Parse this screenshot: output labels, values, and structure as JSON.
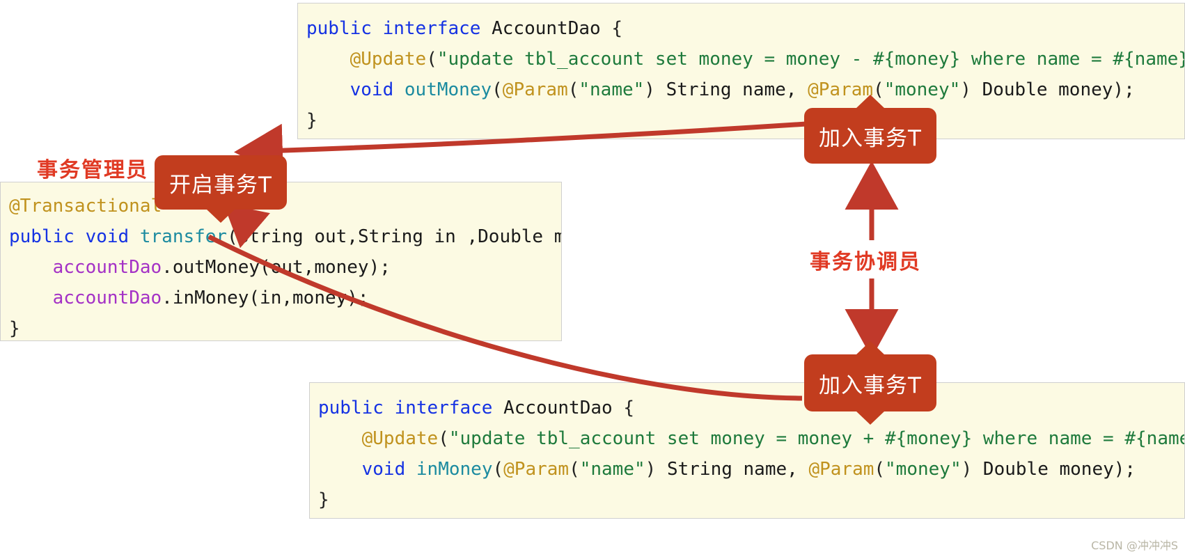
{
  "theme": {
    "code_bg": "#FCFAE3",
    "code_border": "#cfcfcf",
    "badge_bg": "#C23D1E",
    "label_red": "#E03A24",
    "arrow_red": "#C0392B",
    "keyword_blue": "#1532E3",
    "annotation_gold": "#C0921E",
    "string_green": "#1E7A3C",
    "method_teal": "#1C8BA0",
    "field_purple": "#A431C6",
    "page_bg": "#ffffff"
  },
  "labels": {
    "transaction_manager": "事务管理员",
    "transaction_coordinator": "事务协调员"
  },
  "badges": {
    "start_transaction": "开启事务T",
    "join_transaction_top": "加入事务T",
    "join_transaction_bottom": "加入事务T"
  },
  "code_panels": {
    "out_money": {
      "lines": [
        [
          {
            "t": "public",
            "c": "kw"
          },
          {
            "t": " ",
            "c": "plain"
          },
          {
            "t": "interface",
            "c": "kw"
          },
          {
            "t": " ",
            "c": "plain"
          },
          {
            "t": "AccountDao",
            "c": "type"
          },
          {
            "t": " {",
            "c": "punc"
          }
        ],
        [
          {
            "t": "    ",
            "c": "plain"
          },
          {
            "t": "@Update",
            "c": "ann"
          },
          {
            "t": "(",
            "c": "punc"
          },
          {
            "t": "\"update tbl_account set money = money - #{money} where name = #{name}\"",
            "c": "str"
          },
          {
            "t": ")",
            "c": "punc"
          }
        ],
        [
          {
            "t": "    ",
            "c": "plain"
          },
          {
            "t": "void",
            "c": "kw"
          },
          {
            "t": " ",
            "c": "plain"
          },
          {
            "t": "outMoney",
            "c": "mth"
          },
          {
            "t": "(",
            "c": "punc"
          },
          {
            "t": "@Param",
            "c": "ann"
          },
          {
            "t": "(",
            "c": "punc"
          },
          {
            "t": "\"name\"",
            "c": "str"
          },
          {
            "t": ") ",
            "c": "punc"
          },
          {
            "t": "String",
            "c": "type"
          },
          {
            "t": " name, ",
            "c": "plain"
          },
          {
            "t": "@Param",
            "c": "ann"
          },
          {
            "t": "(",
            "c": "punc"
          },
          {
            "t": "\"money\"",
            "c": "str"
          },
          {
            "t": ") ",
            "c": "punc"
          },
          {
            "t": "Double",
            "c": "type"
          },
          {
            "t": " money);",
            "c": "plain"
          }
        ],
        [
          {
            "t": "}",
            "c": "punc"
          }
        ]
      ]
    },
    "transfer": {
      "lines": [
        [
          {
            "t": "@Transactional",
            "c": "ann"
          }
        ],
        [
          {
            "t": "public",
            "c": "kw"
          },
          {
            "t": " ",
            "c": "plain"
          },
          {
            "t": "void",
            "c": "kw"
          },
          {
            "t": " ",
            "c": "plain"
          },
          {
            "t": "transfer",
            "c": "mth"
          },
          {
            "t": "(",
            "c": "punc"
          },
          {
            "t": "String",
            "c": "type"
          },
          {
            "t": " out,",
            "c": "plain"
          },
          {
            "t": "String",
            "c": "type"
          },
          {
            "t": " in ,",
            "c": "plain"
          },
          {
            "t": "Double",
            "c": "type"
          },
          {
            "t": " money) {",
            "c": "plain"
          }
        ],
        [
          {
            "t": "    ",
            "c": "plain"
          },
          {
            "t": "accountDao",
            "c": "field"
          },
          {
            "t": ".outMoney(out,money);",
            "c": "plain"
          }
        ],
        [
          {
            "t": "    ",
            "c": "plain"
          },
          {
            "t": "accountDao",
            "c": "field"
          },
          {
            "t": ".inMoney(in,money);",
            "c": "plain"
          }
        ],
        [
          {
            "t": "}",
            "c": "punc"
          }
        ]
      ]
    },
    "in_money": {
      "lines": [
        [
          {
            "t": "public",
            "c": "kw"
          },
          {
            "t": " ",
            "c": "plain"
          },
          {
            "t": "interface",
            "c": "kw"
          },
          {
            "t": " ",
            "c": "plain"
          },
          {
            "t": "AccountDao",
            "c": "type"
          },
          {
            "t": " {",
            "c": "punc"
          }
        ],
        [
          {
            "t": "    ",
            "c": "plain"
          },
          {
            "t": "@Update",
            "c": "ann"
          },
          {
            "t": "(",
            "c": "punc"
          },
          {
            "t": "\"update tbl_account set money = money + #{money} where name = #{name}\"",
            "c": "str"
          },
          {
            "t": ")",
            "c": "punc"
          }
        ],
        [
          {
            "t": "    ",
            "c": "plain"
          },
          {
            "t": "void",
            "c": "kw"
          },
          {
            "t": " ",
            "c": "plain"
          },
          {
            "t": "inMoney",
            "c": "mth"
          },
          {
            "t": "(",
            "c": "punc"
          },
          {
            "t": "@Param",
            "c": "ann"
          },
          {
            "t": "(",
            "c": "punc"
          },
          {
            "t": "\"name\"",
            "c": "str"
          },
          {
            "t": ") ",
            "c": "punc"
          },
          {
            "t": "String",
            "c": "type"
          },
          {
            "t": " name, ",
            "c": "plain"
          },
          {
            "t": "@Param",
            "c": "ann"
          },
          {
            "t": "(",
            "c": "punc"
          },
          {
            "t": "\"money\"",
            "c": "str"
          },
          {
            "t": ") ",
            "c": "punc"
          },
          {
            "t": "Double",
            "c": "type"
          },
          {
            "t": " money);",
            "c": "plain"
          }
        ],
        [
          {
            "t": "}",
            "c": "punc"
          }
        ]
      ]
    }
  },
  "watermark": "CSDN @冲冲冲S"
}
